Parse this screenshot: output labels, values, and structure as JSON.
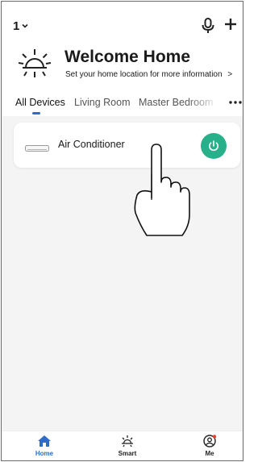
{
  "header": {
    "home_selector": "1",
    "icons": [
      "chevron-down-icon",
      "microphone-icon",
      "plus-icon"
    ]
  },
  "welcome": {
    "title": "Welcome Home",
    "subtitle": "Set your home location for more information",
    "subtitle_arrow": ">",
    "icon": "sun-icon"
  },
  "tabs": {
    "items": [
      "All Devices",
      "Living Room",
      "Master Bedroom"
    ],
    "active": "All Devices",
    "more_icon": "more-dots-icon"
  },
  "devices": [
    {
      "name": "Air Conditioner",
      "icon": "air-conditioner-icon",
      "power_icon": "power-icon"
    }
  ],
  "bottom_nav": {
    "items": [
      {
        "label": "Home",
        "icon": "home-icon",
        "active": true
      },
      {
        "label": "Smart",
        "icon": "sun-icon",
        "active": false
      },
      {
        "label": "Me",
        "icon": "profile-icon",
        "active": false
      }
    ]
  },
  "colors": {
    "accent_blue": "#2f6cc9",
    "power_green": "#28b08a",
    "background": "#f4f4f5",
    "notification_dot": "#e5402f"
  }
}
